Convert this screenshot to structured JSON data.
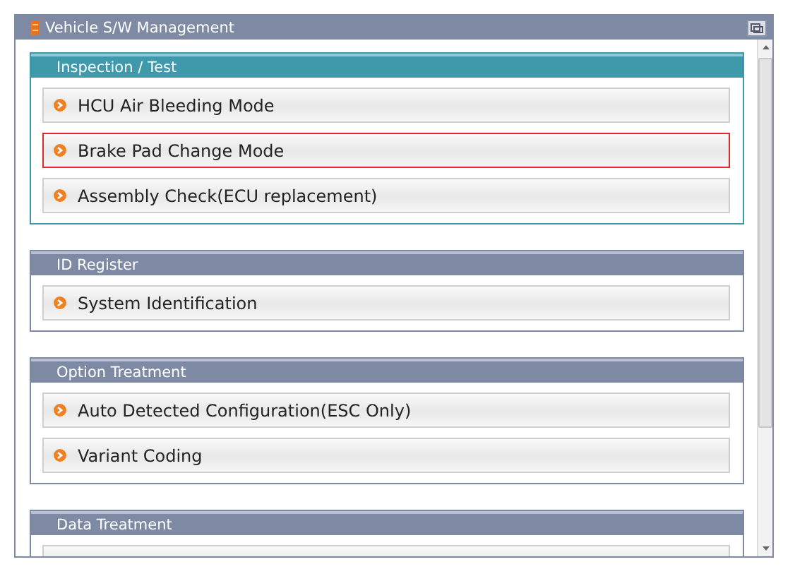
{
  "window": {
    "title": "Vehicle S/W Management"
  },
  "sections": [
    {
      "title": "Inspection / Test",
      "selected": true,
      "items": [
        {
          "label": "HCU Air Bleeding Mode",
          "selected": false
        },
        {
          "label": "Brake Pad Change Mode",
          "selected": true
        },
        {
          "label": "Assembly Check(ECU replacement)",
          "selected": false
        }
      ]
    },
    {
      "title": "ID Register",
      "selected": false,
      "items": [
        {
          "label": "System Identification",
          "selected": false
        }
      ]
    },
    {
      "title": "Option Treatment",
      "selected": false,
      "items": [
        {
          "label": "Auto Detected Configuration(ESC Only)",
          "selected": false
        },
        {
          "label": "Variant Coding",
          "selected": false
        }
      ]
    },
    {
      "title": "Data Treatment",
      "selected": false,
      "items": [
        {
          "selected": false
        }
      ]
    }
  ]
}
